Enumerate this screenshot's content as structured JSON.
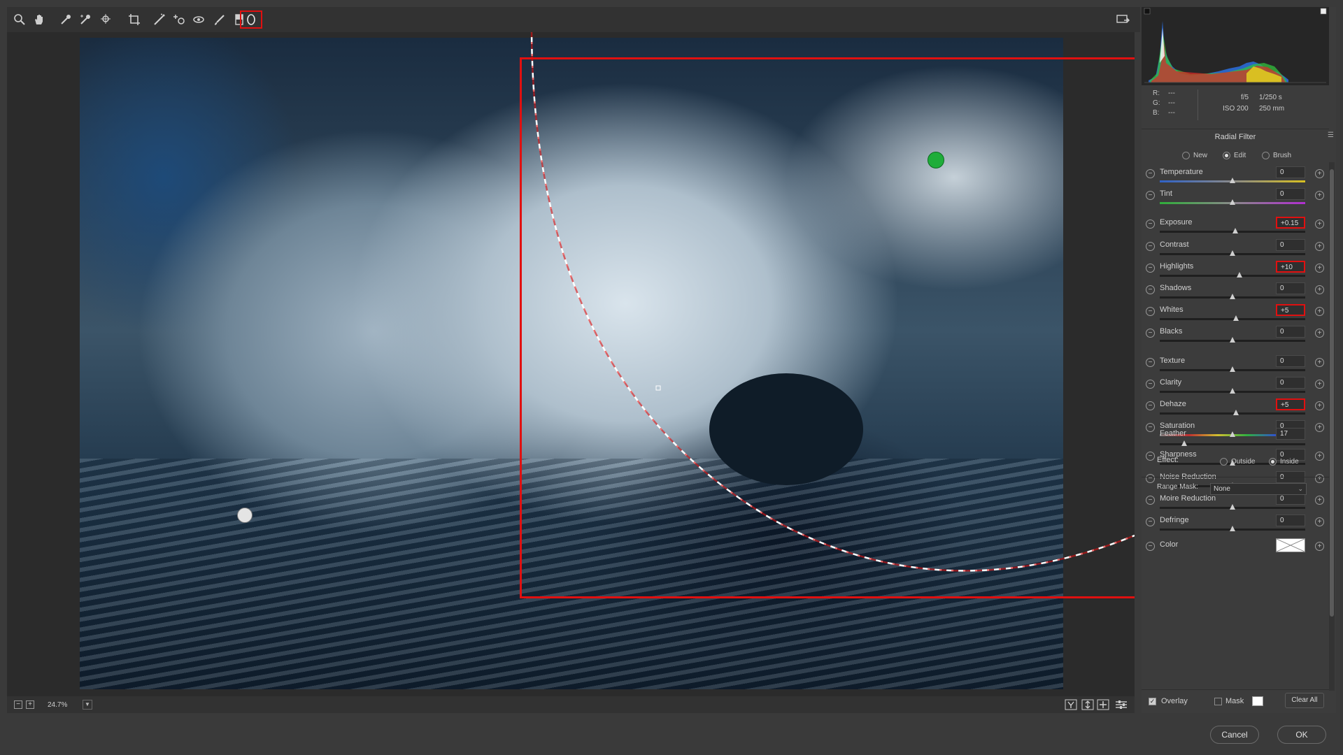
{
  "toolbar": {
    "tools": [
      {
        "name": "zoom-tool",
        "icon": "magnifier-icon"
      },
      {
        "name": "hand-tool",
        "icon": "hand-icon"
      },
      {
        "name": "white-balance-tool",
        "icon": "eyedropper-icon"
      },
      {
        "name": "color-sampler-tool",
        "icon": "eyedropper-plus-icon"
      },
      {
        "name": "targeted-adjustment-tool",
        "icon": "target-icon"
      },
      {
        "name": "crop-tool",
        "icon": "crop-icon"
      },
      {
        "name": "straighten-tool",
        "icon": "straighten-icon"
      },
      {
        "name": "spot-removal-tool",
        "icon": "spot-removal-icon"
      },
      {
        "name": "red-eye-tool",
        "icon": "red-eye-icon"
      },
      {
        "name": "adjustment-brush-tool",
        "icon": "brush-icon"
      },
      {
        "name": "graduated-filter-tool",
        "icon": "graduated-filter-icon"
      },
      {
        "name": "radial-filter-tool",
        "icon": "ellipse-icon",
        "active": true
      }
    ]
  },
  "status": {
    "zoom": "24.7%"
  },
  "readout": {
    "r_label": "R:",
    "r_value": "---",
    "g_label": "G:",
    "g_value": "---",
    "b_label": "B:",
    "b_value": "---",
    "aperture": "f/5",
    "shutter": "1/250 s",
    "iso": "ISO 200",
    "focal": "250 mm"
  },
  "panel": {
    "title": "Radial Filter",
    "modes": [
      {
        "label": "New",
        "selected": false
      },
      {
        "label": "Edit",
        "selected": true
      },
      {
        "label": "Brush",
        "selected": false
      }
    ],
    "sliders": [
      {
        "label": "Temperature",
        "value": "0",
        "highlight": false,
        "pos": 0.5
      },
      {
        "label": "Tint",
        "value": "0",
        "highlight": false,
        "pos": 0.5
      },
      {
        "label": "Exposure",
        "value": "+0.15",
        "highlight": true,
        "pos": 0.52
      },
      {
        "label": "Contrast",
        "value": "0",
        "highlight": false,
        "pos": 0.5
      },
      {
        "label": "Highlights",
        "value": "+10",
        "highlight": true,
        "pos": 0.55
      },
      {
        "label": "Shadows",
        "value": "0",
        "highlight": false,
        "pos": 0.5
      },
      {
        "label": "Whites",
        "value": "+5",
        "highlight": true,
        "pos": 0.525
      },
      {
        "label": "Blacks",
        "value": "0",
        "highlight": false,
        "pos": 0.5
      },
      {
        "label": "Texture",
        "value": "0",
        "highlight": false,
        "pos": 0.5
      },
      {
        "label": "Clarity",
        "value": "0",
        "highlight": false,
        "pos": 0.5
      },
      {
        "label": "Dehaze",
        "value": "+5",
        "highlight": true,
        "pos": 0.525
      },
      {
        "label": "Saturation",
        "value": "0",
        "highlight": false,
        "pos": 0.5
      },
      {
        "label": "Sharpness",
        "value": "0",
        "highlight": false,
        "pos": 0.5
      },
      {
        "label": "Noise Reduction",
        "value": "0",
        "highlight": false,
        "pos": 0.5
      },
      {
        "label": "Moire Reduction",
        "value": "0",
        "highlight": false,
        "pos": 0.5
      },
      {
        "label": "Defringe",
        "value": "0",
        "highlight": false,
        "pos": 0.5
      }
    ],
    "color_label": "Color",
    "feather_label": "Feather",
    "feather_value": "17",
    "feather_pos": 0.17,
    "effect_label": "Effect:",
    "effect_outside": "Outside",
    "effect_inside": "Inside",
    "effect_selected": "Inside",
    "range_mask_label": "Range Mask:",
    "range_mask_value": "None",
    "overlay_label": "Overlay",
    "overlay_checked": true,
    "mask_label": "Mask",
    "mask_checked": false,
    "clear_all_label": "Clear All"
  },
  "footer": {
    "cancel_label": "Cancel",
    "ok_label": "OK"
  },
  "colors": {
    "highlight_red": "#e01010",
    "pin_green": "#1fad3a",
    "panel_bg": "#3c3c3c"
  }
}
